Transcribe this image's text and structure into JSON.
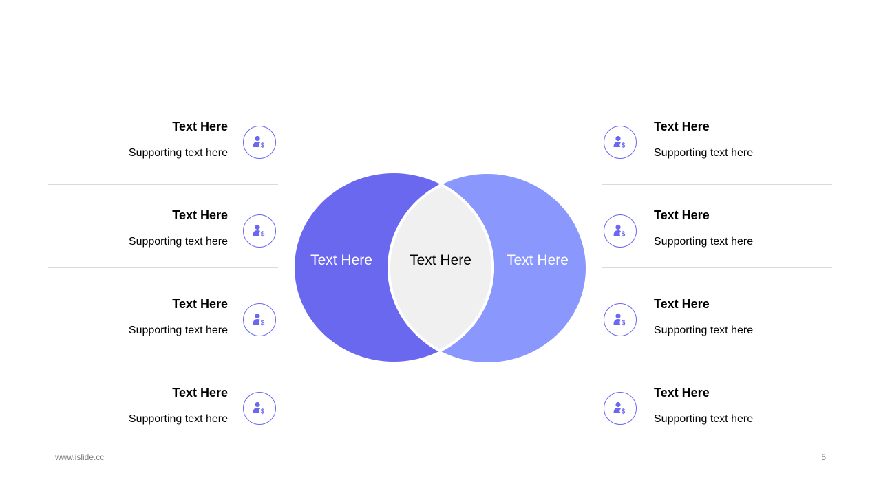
{
  "left_items": [
    {
      "title": "Text Here",
      "subtitle": "Supporting text here",
      "icon": "user-dollar-icon"
    },
    {
      "title": "Text Here",
      "subtitle": "Supporting text here",
      "icon": "user-dollar-icon"
    },
    {
      "title": "Text Here",
      "subtitle": "Supporting text here",
      "icon": "user-dollar-icon"
    },
    {
      "title": "Text Here",
      "subtitle": "Supporting text here",
      "icon": "user-dollar-icon"
    }
  ],
  "right_items": [
    {
      "title": "Text Here",
      "subtitle": "Supporting text here",
      "icon": "user-dollar-icon"
    },
    {
      "title": "Text Here",
      "subtitle": "Supporting text here",
      "icon": "user-dollar-icon"
    },
    {
      "title": "Text Here",
      "subtitle": "Supporting text here",
      "icon": "user-dollar-icon"
    },
    {
      "title": "Text Here",
      "subtitle": "Supporting text here",
      "icon": "user-dollar-icon"
    }
  ],
  "venn": {
    "left_label": "Text Here",
    "center_label": "Text Here",
    "right_label": "Text Here",
    "left_color": "#6b68f0",
    "right_color": "#8a98fd",
    "center_color": "#f0f0f0"
  },
  "colors": {
    "accent": "#6b68f0"
  },
  "footer": {
    "url": "www.islide.cc",
    "page_number": "5"
  }
}
